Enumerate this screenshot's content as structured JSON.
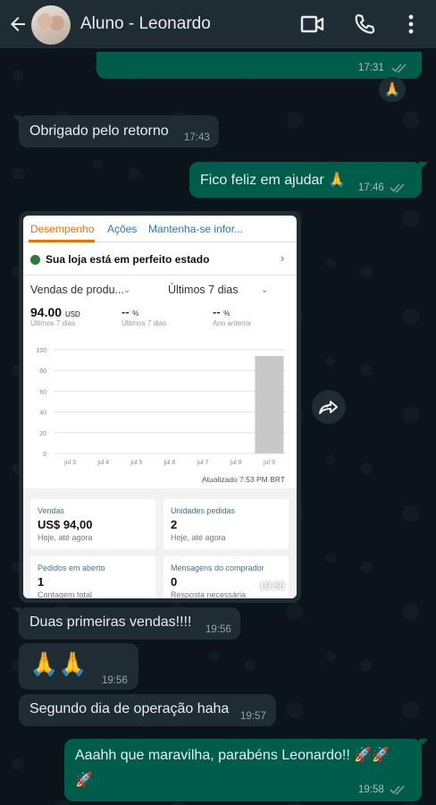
{
  "header": {
    "contact_name": "Aluno - Leonardo"
  },
  "messages": {
    "m0": {
      "time": "17:31",
      "reaction": "🙏"
    },
    "m1": {
      "text": "Obrigado pelo retorno",
      "time": "17:43"
    },
    "m2": {
      "text": "Fico feliz em ajudar 🙏",
      "time": "17:46"
    },
    "m3": {
      "time": "19:56"
    },
    "m4": {
      "text": "Duas primeiras vendas!!!!",
      "time": "19:56"
    },
    "m5": {
      "text": "🙏🙏",
      "time": "19:56"
    },
    "m6": {
      "text": "Segundo dia de operação haha",
      "time": "19:57"
    },
    "m7": {
      "text_line1": "Aaahh que maravilha, parabéns Leonardo!! 🚀🚀",
      "text_line2": "🚀",
      "time": "19:58"
    }
  },
  "screenshot": {
    "tabs": [
      "Desempenho",
      "Ações",
      "Mantenha-se infor..."
    ],
    "status": "Sua loja está em perfeito estado",
    "select_left": "Vendas de produ...",
    "select_right": "Últimos 7 dias",
    "total": "94.00",
    "total_unit": "USD",
    "total_sub": "Últimos 7 dias",
    "cmp1": "--",
    "cmp1_unit": "%",
    "cmp1_sub": "Últimos 7 dias",
    "cmp2": "--",
    "cmp2_unit": "%",
    "cmp2_sub": "Ano anterior",
    "updated": "Atualizado 7:53 PM BRT",
    "metrics": [
      {
        "label": "Vendas",
        "value": "US$ 94,00",
        "sub": "Hoje, até agora"
      },
      {
        "label": "Unidades pedidas",
        "value": "2",
        "sub": "Hoje, até agora"
      },
      {
        "label": "Pedidos em aberto",
        "value": "1",
        "sub": "Contagem total"
      },
      {
        "label": "Mensagens do comprador",
        "value": "0",
        "sub": "Resposta necessária"
      }
    ]
  },
  "chart_data": {
    "type": "bar",
    "categories": [
      "jul 3",
      "jul 4",
      "jul 5",
      "jul 6",
      "jul 7",
      "jul 8",
      "jul 9"
    ],
    "values": [
      0,
      0,
      0,
      0,
      0,
      0,
      94
    ],
    "yticks": [
      "0",
      "20",
      "40",
      "60",
      "80",
      "100"
    ],
    "ylim": [
      0,
      100
    ],
    "grid": true,
    "colors": {
      "bar": "#c8c8c8",
      "grid": "#e3e3e3"
    }
  },
  "colors": {
    "header_bg": "#1f2c34",
    "incoming_bubble": "#1f2c34",
    "outgoing_bubble": "#005c4b",
    "read_ticks": "#8696a0",
    "chat_bg": "#0b141a"
  }
}
